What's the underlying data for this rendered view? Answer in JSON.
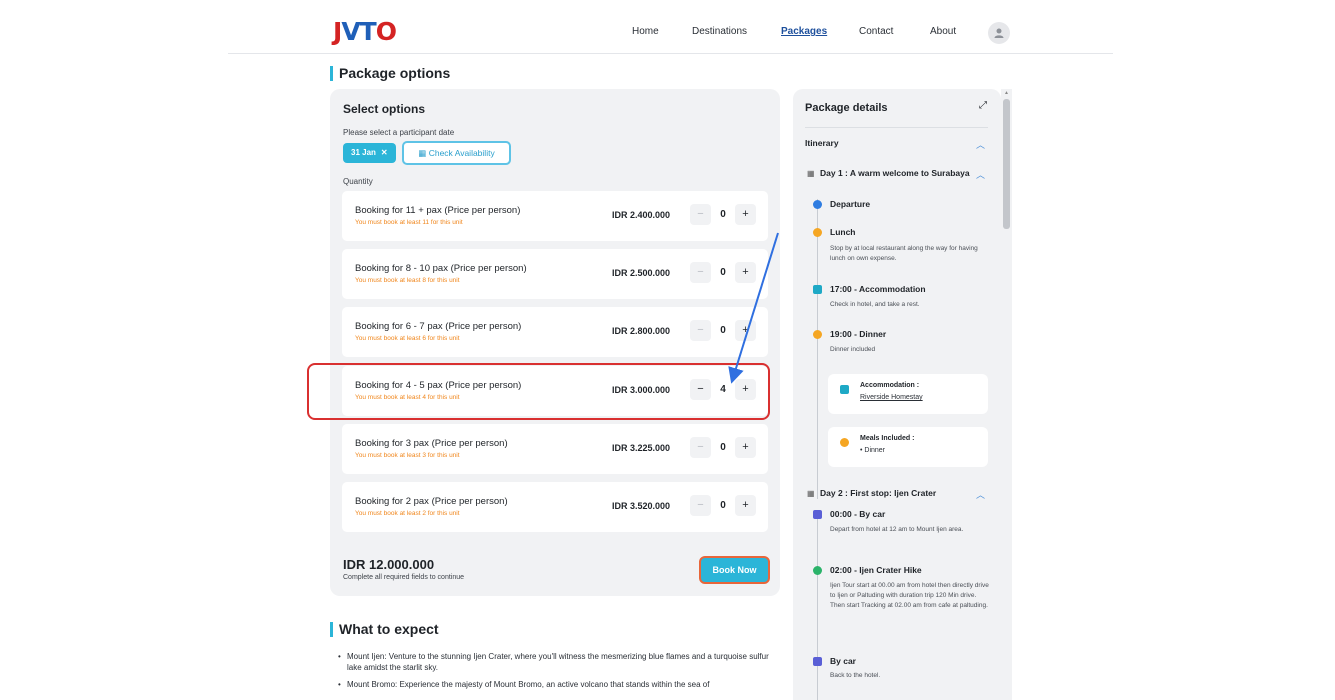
{
  "header": {
    "logo": {
      "j": "J",
      "v": "V",
      "t": "T",
      "o": "O"
    },
    "nav": [
      {
        "label": "Home"
      },
      {
        "label": "Destinations"
      },
      {
        "label": "Packages"
      },
      {
        "label": "Contact"
      },
      {
        "label": "About"
      }
    ],
    "active_nav": "Packages"
  },
  "package_options": {
    "title": "Package options",
    "select_title": "Select options",
    "date_label": "Please select a participant date",
    "date_chip": "31 Jan",
    "check_label": "Check Availability",
    "quantity_label": "Quantity",
    "rows": [
      {
        "title": "Booking for 11 + pax (Price per person)",
        "sub": "You must book at least 11 for this unit",
        "price": "IDR 2.400.000",
        "qty": "0"
      },
      {
        "title": "Booking for 8 - 10 pax (Price per person)",
        "sub": "You must book at least 8 for this unit",
        "price": "IDR 2.500.000",
        "qty": "0"
      },
      {
        "title": "Booking for 6 - 7 pax (Price per person)",
        "sub": "You must book at least 6 for this unit",
        "price": "IDR 2.800.000",
        "qty": "0"
      },
      {
        "title": "Booking for 4 - 5 pax (Price per person)",
        "sub": "You must book at least 4 for this unit",
        "price": "IDR 3.000.000",
        "qty": "4"
      },
      {
        "title": "Booking for 3 pax (Price per person)",
        "sub": "You must book at least 3 for this unit",
        "price": "IDR 3.225.000",
        "qty": "0"
      },
      {
        "title": "Booking for 2 pax (Price per person)",
        "sub": "You must book at least 2 for this unit",
        "price": "IDR 3.520.000",
        "qty": "0"
      }
    ],
    "minus": "−",
    "plus": "+",
    "total": "IDR 12.000.000",
    "total_note": "Complete all required fields to continue",
    "book_label": "Book Now"
  },
  "what_to_expect": {
    "title": "What to expect",
    "items": [
      "Mount Ijen: Venture to the stunning Ijen Crater, where you'll witness the mesmerizing blue flames and a turquoise sulfur lake amidst the starlit sky.",
      "Mount Bromo: Experience the majesty of Mount Bromo, an active volcano that stands within the sea of"
    ]
  },
  "package_details": {
    "title": "Package details",
    "itinerary": "Itinerary",
    "day1": "Day 1 : A warm welcome to Surabaya",
    "day1_items": [
      {
        "title": "Departure",
        "desc": "",
        "icon": "location-pin-icon",
        "color": "#2f7de1"
      },
      {
        "title": "Lunch",
        "desc": "Stop by at local restaurant along the way for having lunch on own expense.",
        "icon": "meal-icon",
        "color": "#f5a623"
      },
      {
        "title": "17:00 - Accommodation",
        "desc": "Check in hotel, and take a rest.",
        "icon": "hotel-icon",
        "color": "#1ea9c6"
      },
      {
        "title": "19:00 - Dinner",
        "desc": "Dinner included",
        "icon": "meal-icon",
        "color": "#f5a623"
      }
    ],
    "accommodation_card": {
      "title": "Accommodation :",
      "value": "Riverside Homestay"
    },
    "meals_card": {
      "title": "Meals Included :",
      "value": "•  Dinner"
    },
    "day2": "Day 2 : First stop: Ijen Crater",
    "day2_items": [
      {
        "title": "00:00 - By car",
        "desc": "Depart from hotel at 12 am to Mount Ijen area.",
        "icon": "car-icon",
        "color": "#5a5fd6"
      },
      {
        "title": "02:00 - Ijen Crater Hike",
        "desc": "Ijen Tour start at 00.00 am from hotel then directly drive to Ijen or Paltuding with duration trip 120 Min drive. Then start Tracking at 02.00 am from cafe at paltuding.",
        "icon": "hike-icon",
        "color": "#2bb36a"
      },
      {
        "title": "By car",
        "desc": "Back to the hotel.",
        "icon": "car-icon",
        "color": "#5a5fd6"
      }
    ]
  },
  "colors": {
    "accent": "#2bb5d8",
    "warning": "#f0861c",
    "annotation": "#d93030",
    "arrow": "#2f6fe0"
  }
}
